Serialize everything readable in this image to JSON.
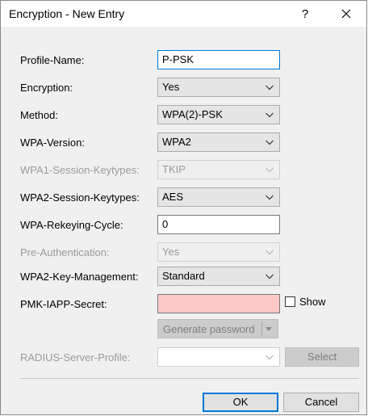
{
  "window": {
    "title": "Encryption - New Entry",
    "help_label": "?"
  },
  "fields": {
    "profile_name": {
      "label": "Profile-Name:",
      "value": "P-PSK"
    },
    "encryption": {
      "label": "Encryption:",
      "value": "Yes"
    },
    "method": {
      "label": "Method:",
      "value": "WPA(2)-PSK"
    },
    "wpa_version": {
      "label": "WPA-Version:",
      "value": "WPA2"
    },
    "wpa1_session_keytypes": {
      "label": "WPA1-Session-Keytypes:",
      "value": "TKIP"
    },
    "wpa2_session_keytypes": {
      "label": "WPA2-Session-Keytypes:",
      "value": "AES"
    },
    "wpa_rekeying_cycle": {
      "label": "WPA-Rekeying-Cycle:",
      "value": "0"
    },
    "pre_authentication": {
      "label": "Pre-Authentication:",
      "value": "Yes"
    },
    "wpa2_key_management": {
      "label": "WPA2-Key-Management:",
      "value": "Standard"
    },
    "pmk_iapp_secret": {
      "label": "PMK-IAPP-Secret:",
      "value": "",
      "show_label": "Show"
    },
    "radius_server_profile": {
      "label": "RADIUS-Server-Profile:",
      "value": ""
    }
  },
  "buttons": {
    "generate_password": "Generate password",
    "select": "Select",
    "ok": "OK",
    "cancel": "Cancel"
  },
  "colors": {
    "accent": "#0078d7",
    "secret_field_bg": "#ffc8c8"
  },
  "icons": {
    "dropdown": "chevron-down-icon",
    "close": "close-icon",
    "split": "triangle-down-icon"
  }
}
